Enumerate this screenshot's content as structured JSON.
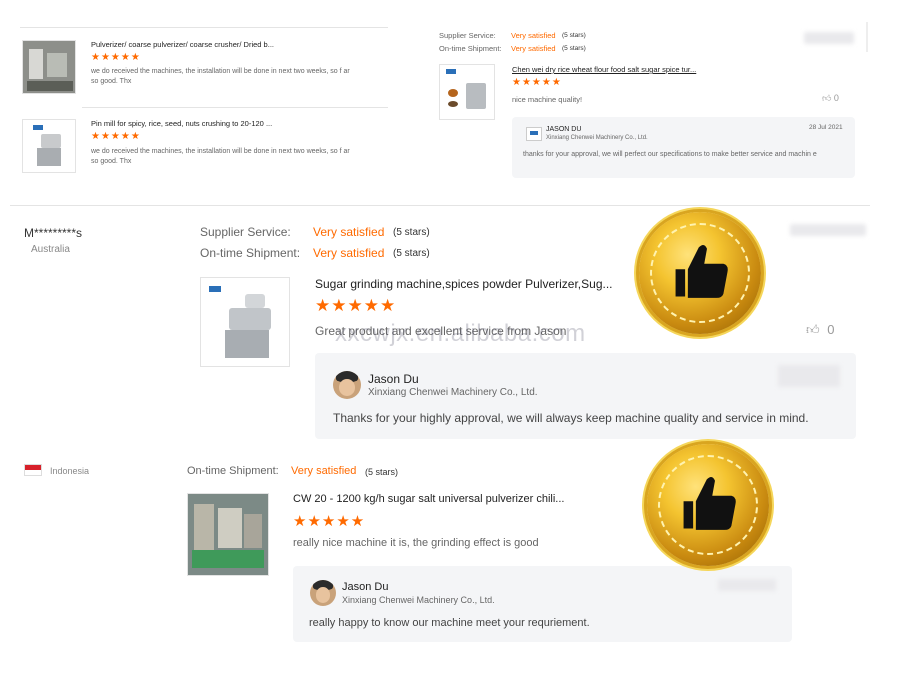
{
  "top_left": {
    "items": [
      {
        "title": "Pulverizer/ coarse pulverizer/ coarse crusher/ Dried b...",
        "stars": "★★★★★",
        "comment": "we do received the machines, the installation will be done in next two weeks, so f ar so good. Thx"
      },
      {
        "title": "Pin mill for spicy, rice, seed, nuts crushing to 20-120 ...",
        "stars": "★★★★★",
        "comment": "we do received the machines, the installation will be done in next two weeks, so f ar so good. Thx"
      }
    ]
  },
  "top_right": {
    "supplier_label": "Supplier Service:",
    "supplier_value": "Very satisfied",
    "supplier_stars": "(5 stars)",
    "shipment_label": "On-time Shipment:",
    "shipment_value": "Very satisfied",
    "shipment_stars": "(5 stars)",
    "product_title": "Chen wei dry rice wheat flour food salt sugar spice tur...",
    "stars": "★★★★★",
    "comment": "nice machine quality!",
    "like_count": "0",
    "reply": {
      "name": "JASON DU",
      "company": "Xinxiang Chenwei Machinery Co., Ltd.",
      "date": "28 Jul 2021",
      "text": "thanks for your approval, we will perfect our specifications to make better service and machin e"
    }
  },
  "review_main": {
    "buyer_name": "M*********s",
    "buyer_country": "Australia",
    "supplier_label": "Supplier Service:",
    "supplier_value": "Very satisfied",
    "supplier_stars": "(5 stars)",
    "shipment_label": "On-time Shipment:",
    "shipment_value": "Very satisfied",
    "shipment_stars": "(5 stars)",
    "product_title": "Sugar grinding machine,spices powder Pulverizer,Sug...",
    "stars": "★★★★★",
    "comment": "Great product and excellent service from Jason",
    "like_count": "0",
    "reply": {
      "name": "Jason Du",
      "company": "Xinxiang Chenwei Machinery Co., Ltd.",
      "text": "Thanks for your highly approval, we will always keep machine quality and service in mind."
    }
  },
  "review_bottom": {
    "buyer_country": "Indonesia",
    "shipment_label": "On-time Shipment:",
    "shipment_value": "Very satisfied",
    "shipment_stars": "(5 stars)",
    "product_title": "CW 20 - 1200 kg/h sugar salt universal pulverizer chili...",
    "stars": "★★★★★",
    "comment": "really nice machine it is, the grinding effect is good",
    "reply": {
      "name": "Jason Du",
      "company": "Xinxiang Chenwei Machinery Co., Ltd.",
      "text": "really happy to know our machine meet your requriement."
    }
  },
  "watermark": "xxcwjx.en.alibaba.com",
  "colors": {
    "accent": "#ff6a00",
    "badge_gold": "#f4c430"
  }
}
